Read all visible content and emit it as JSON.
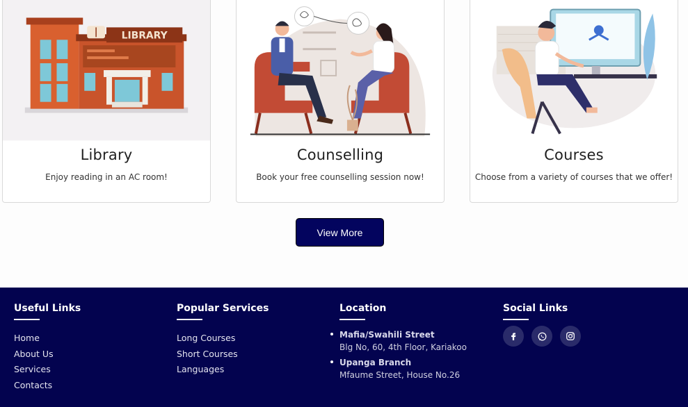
{
  "cards": [
    {
      "title": "Library",
      "description": "Enjoy reading in an AC room!",
      "sign": "LIBRARY"
    },
    {
      "title": "Counselling",
      "description": "Book your free counselling session now!"
    },
    {
      "title": "Courses",
      "description": "Choose from a variety of courses that we offer!"
    }
  ],
  "view_more": {
    "label": "View More"
  },
  "footer": {
    "useful_links": {
      "heading": "Useful Links",
      "items": [
        "Home",
        "About Us",
        "Services",
        "Contacts"
      ]
    },
    "popular_services": {
      "heading": "Popular Services",
      "items": [
        "Long Courses",
        "Short Courses",
        "Languages"
      ]
    },
    "location": {
      "heading": "Location",
      "items": [
        {
          "name": "Mafia/Swahili Street",
          "address": "Blg No, 60, 4th Floor, Kariakoo"
        },
        {
          "name": "Upanga Branch",
          "address": "Mfaume Street, House No.26"
        }
      ]
    },
    "social": {
      "heading": "Social Links",
      "icons": [
        "facebook-icon",
        "whatsapp-icon",
        "instagram-icon"
      ]
    }
  },
  "colors": {
    "navy": "#03045e",
    "footer_bg": "#03034f",
    "social_bg": "#2a2b6a"
  }
}
